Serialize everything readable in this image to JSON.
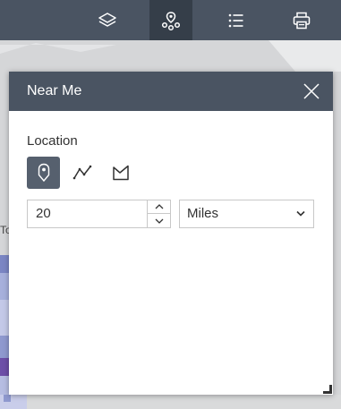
{
  "map": {
    "partial_label": "To"
  },
  "toolbar": {
    "buttons": [
      {
        "icon": "layers-icon",
        "active": false
      },
      {
        "icon": "near-me-icon",
        "active": true
      },
      {
        "icon": "list-icon",
        "active": false
      },
      {
        "icon": "print-icon",
        "active": false
      }
    ]
  },
  "panel": {
    "title": "Near Me",
    "location_label": "Location",
    "modes": [
      "point-mode",
      "polyline-mode",
      "polygon-mode"
    ],
    "active_mode": "point-mode",
    "distance": {
      "value": "20"
    },
    "unit": {
      "selected": "Miles"
    }
  },
  "colors": {
    "header_bg": "#4a5462",
    "active_tool_bg": "#353e49",
    "active_mode_bg": "#56606e"
  }
}
